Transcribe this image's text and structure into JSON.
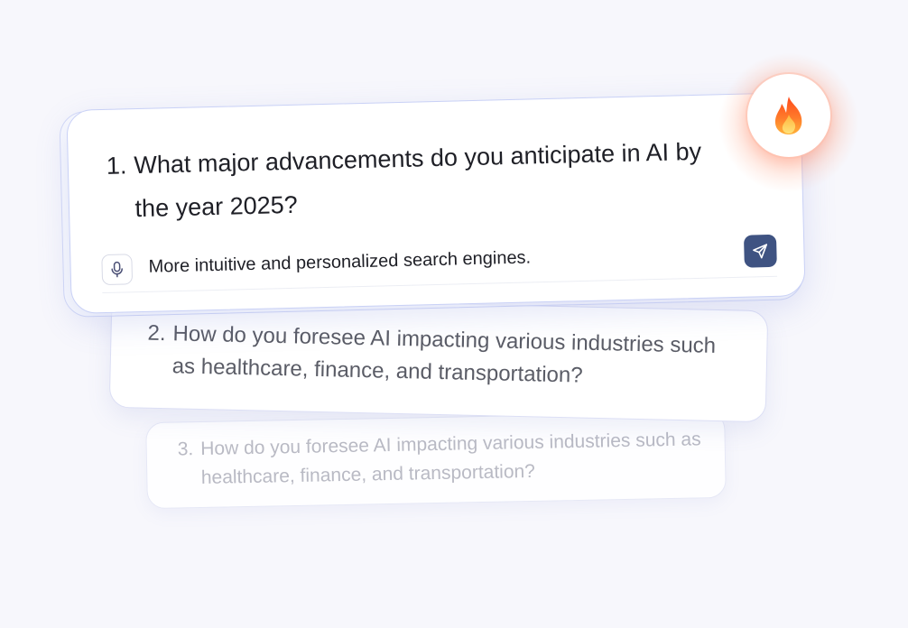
{
  "questions": [
    {
      "number": "1.",
      "text": "What major advancements do you anticipate in AI by the year 2025?",
      "answer": "More intuitive and personalized search engines."
    },
    {
      "number": "2.",
      "text": "How do you foresee AI impacting various industries such as healthcare, finance, and transportation?"
    },
    {
      "number": "3.",
      "text": "How do you foresee AI impacting various industries such as healthcare, finance, and transportation?"
    }
  ],
  "icons": {
    "mic": "microphone-icon",
    "send": "send-icon",
    "badge": "fire-icon"
  },
  "colors": {
    "send_button": "#3f5382",
    "fire_orange": "#ff6a2b",
    "fire_yellow": "#ffc93c"
  }
}
